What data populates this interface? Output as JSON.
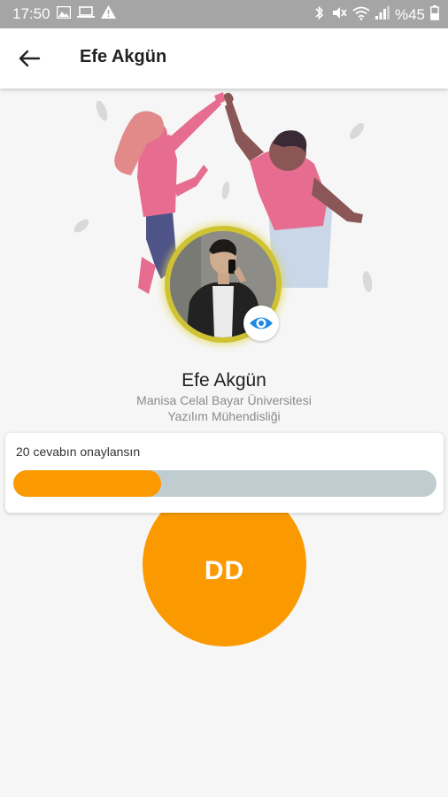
{
  "status_bar": {
    "time": "17:50",
    "battery": "%45",
    "left_icons": [
      "image-icon",
      "laptop-icon",
      "warning-icon"
    ],
    "right_icons": [
      "bluetooth-icon",
      "mute-icon",
      "wifi-icon",
      "signal-icon",
      "battery-icon"
    ]
  },
  "app_bar": {
    "title": "Efe Akgün",
    "back_icon": "arrow-back-icon"
  },
  "profile": {
    "name": "Efe Akgün",
    "university": "Manisa Celal Bayar Üniversitesi",
    "department": "Yazılım Mühendisliği",
    "view_icon": "eye-icon"
  },
  "progress_card": {
    "label": "20 cevabın onaylansın",
    "progress": 0.35
  },
  "badge": {
    "label": "DD"
  },
  "colors": {
    "accent": "#fa9a00",
    "track": "#c0cdd0",
    "eye": "#1e88e5",
    "avatar_ring": "#cfc233"
  }
}
